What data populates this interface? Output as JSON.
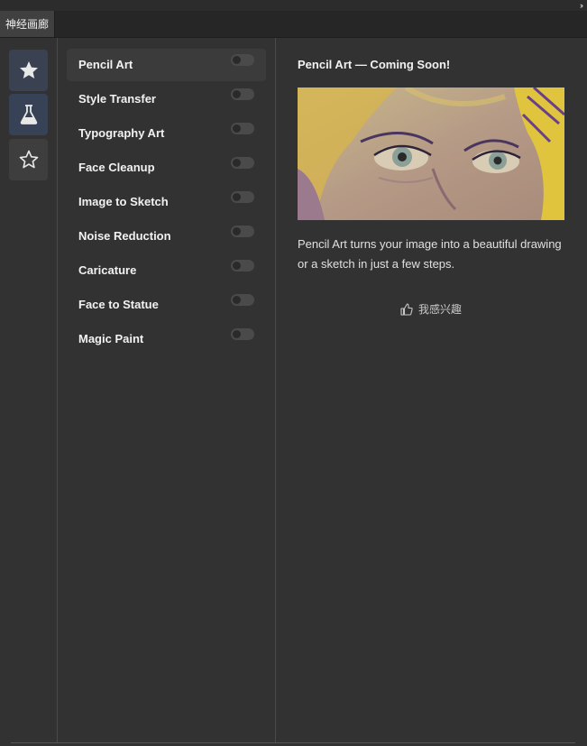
{
  "window": {
    "tab_label": "神经画廊"
  },
  "side_icons": [
    "star-filled-icon",
    "flask-icon",
    "star-outline-icon"
  ],
  "filters": [
    {
      "label": "Pencil Art",
      "enabled": false,
      "active": true
    },
    {
      "label": "Style Transfer",
      "enabled": false
    },
    {
      "label": "Typography Art",
      "enabled": false
    },
    {
      "label": "Face Cleanup",
      "enabled": false
    },
    {
      "label": "Image to Sketch",
      "enabled": false
    },
    {
      "label": "Noise Reduction",
      "enabled": false
    },
    {
      "label": "Caricature",
      "enabled": false
    },
    {
      "label": "Face to Statue",
      "enabled": false
    },
    {
      "label": "Magic Paint",
      "enabled": false
    }
  ],
  "detail": {
    "title": "Pencil Art — Coming Soon!",
    "description": "Pencil Art turns your image into a beautiful drawing or a sketch in just a few steps.",
    "interest_label": "我感兴趣"
  },
  "colors": {
    "background": "#323232",
    "accent_active_icon": "#374256"
  }
}
